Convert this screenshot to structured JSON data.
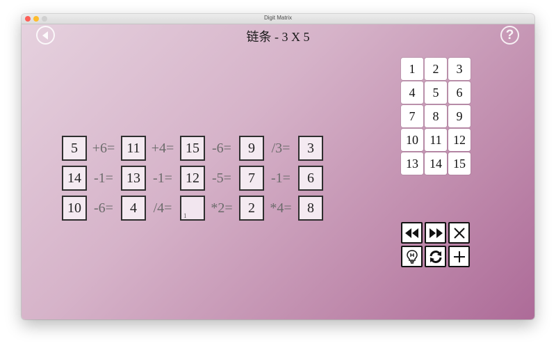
{
  "window": {
    "title": "Digit Matrix"
  },
  "header": {
    "title": "链条 - 3 X 5",
    "back_icon": "back-arrow-icon",
    "help_icon": "question-mark-icon",
    "help_glyph": "?"
  },
  "puzzle": {
    "rows": [
      {
        "cells": [
          "5",
          "11",
          "15",
          "9",
          "3"
        ],
        "ops": [
          "+6=",
          "+4=",
          "-6=",
          "/3="
        ]
      },
      {
        "cells": [
          "14",
          "13",
          "12",
          "7",
          "6"
        ],
        "ops": [
          "-1=",
          "-1=",
          "-5=",
          "-1="
        ]
      },
      {
        "cells": [
          "10",
          "4",
          "",
          "2",
          "8"
        ],
        "ops": [
          "-6=",
          "/4=",
          "*2=",
          "*4="
        ],
        "empty_cell_hint": "1"
      }
    ]
  },
  "numpad": {
    "keys": [
      "1",
      "2",
      "3",
      "4",
      "5",
      "6",
      "7",
      "8",
      "9",
      "10",
      "11",
      "12",
      "13",
      "14",
      "15"
    ]
  },
  "tools": {
    "buttons": [
      {
        "icon": "rewind-icon"
      },
      {
        "icon": "fast-forward-icon"
      },
      {
        "icon": "close-x-icon"
      },
      {
        "icon": "hint-bulb-icon"
      },
      {
        "icon": "refresh-icon"
      },
      {
        "icon": "plus-icon"
      }
    ]
  },
  "colors": {
    "background_start": "#e6d2df",
    "background_end": "#ad6b98",
    "cell_fill": "#f4eaf1",
    "operator_text": "#6b6b6b"
  }
}
